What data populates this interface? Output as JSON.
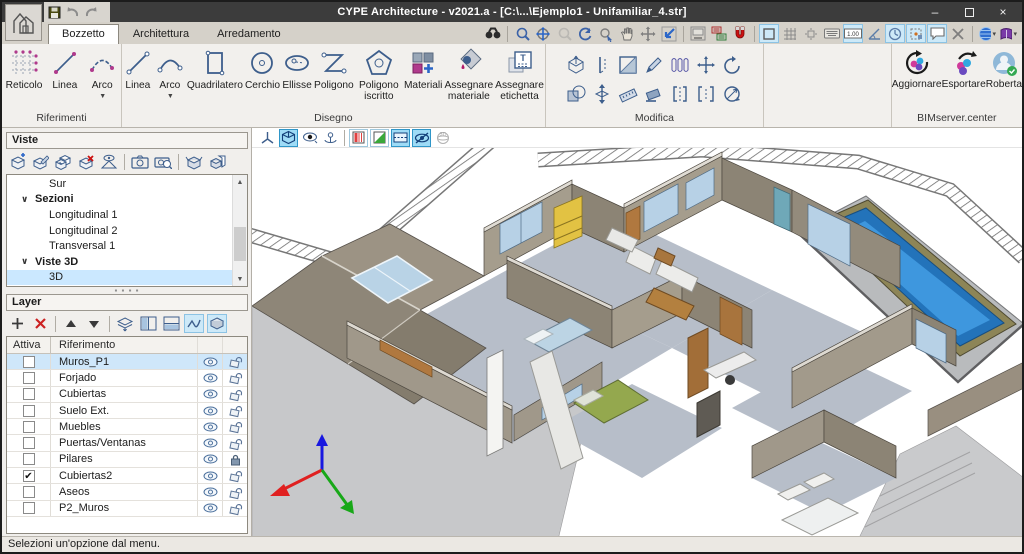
{
  "window": {
    "title": "CYPE Architecture - v2021.a - [C:\\...\\Ejemplo1 - Unifamiliar_4.str]",
    "controls": {
      "minimize": "–",
      "close": "×"
    }
  },
  "tabs": [
    {
      "label": "Bozzetto",
      "active": true
    },
    {
      "label": "Architettura",
      "active": false
    },
    {
      "label": "Arredamento",
      "active": false
    }
  ],
  "ribbon": {
    "riferimenti": {
      "label": "Riferimenti",
      "items": [
        {
          "label": "Reticolo"
        },
        {
          "label": "Linea"
        },
        {
          "label": "Arco"
        }
      ]
    },
    "disegno": {
      "label": "Disegno",
      "items": [
        {
          "label": "Linea"
        },
        {
          "label": "Arco"
        },
        {
          "label": "Quadrilatero"
        },
        {
          "label": "Cerchio"
        },
        {
          "label": "Ellisse"
        },
        {
          "label": "Poligono"
        },
        {
          "label": "Poligono iscritto"
        },
        {
          "label": "Materiali"
        },
        {
          "label": "Assegnare materiale"
        },
        {
          "label": "Assegnare etichetta"
        }
      ]
    },
    "modifica": {
      "label": "Modifica"
    },
    "bimserver": {
      "label": "BIMserver.center",
      "items": [
        {
          "label": "Aggiornare"
        },
        {
          "label": "Esportare"
        },
        {
          "label": "Roberta"
        }
      ]
    }
  },
  "toolbar_icons": {
    "dimension_label": "1.00",
    "threeD_label": "3D"
  },
  "viste": {
    "title": "Viste",
    "items": [
      {
        "label": "Sur",
        "level": 2
      },
      {
        "label": "Sezioni",
        "level": 1,
        "expanded": true
      },
      {
        "label": "Longitudinal 1",
        "level": 2
      },
      {
        "label": "Longitudinal 2",
        "level": 2
      },
      {
        "label": "Transversal 1",
        "level": 2
      },
      {
        "label": "Viste 3D",
        "level": 1,
        "expanded": true
      },
      {
        "label": "3D",
        "level": 2,
        "selected": true
      }
    ]
  },
  "layer": {
    "title": "Layer",
    "header": {
      "attiva": "Attiva",
      "riferimento": "Riferimento"
    },
    "rows": [
      {
        "name": "Muros_P1",
        "checked": false,
        "locked": false,
        "selected": true
      },
      {
        "name": "Forjado",
        "checked": false,
        "locked": false
      },
      {
        "name": "Cubiertas",
        "checked": false,
        "locked": false
      },
      {
        "name": "Suelo Ext.",
        "checked": false,
        "locked": false
      },
      {
        "name": "Muebles",
        "checked": false,
        "locked": false
      },
      {
        "name": "Puertas/Ventanas",
        "checked": false,
        "locked": false
      },
      {
        "name": "Pilares",
        "checked": false,
        "locked": true
      },
      {
        "name": "Cubiertas2",
        "checked": true,
        "locked": false
      },
      {
        "name": "Aseos",
        "checked": false,
        "locked": false
      },
      {
        "name": "P2_Muros",
        "checked": false,
        "locked": false
      }
    ]
  },
  "statusbar": {
    "text": "Selezioni un'opzione dal menu."
  },
  "palette": {
    "titlebar": "#3c3c3c",
    "highlight": "#cde9f8",
    "selection": "#cfe7fa",
    "wall_light": "#a59d8d",
    "wall_dark": "#8c8475",
    "roof": "#8e8678",
    "floor": "#b7bec9",
    "ground": "#c7c8ca",
    "window_glass": "#b7d1e6",
    "door_wood": "#b0783f",
    "pool_water": "#2e86cf",
    "pool_frame": "#8d8557",
    "bed_green": "#94a84e",
    "bunk_yellow": "#e2c243",
    "axis_x": "#e02020",
    "axis_y": "#18a818",
    "axis_z": "#1818e0"
  }
}
